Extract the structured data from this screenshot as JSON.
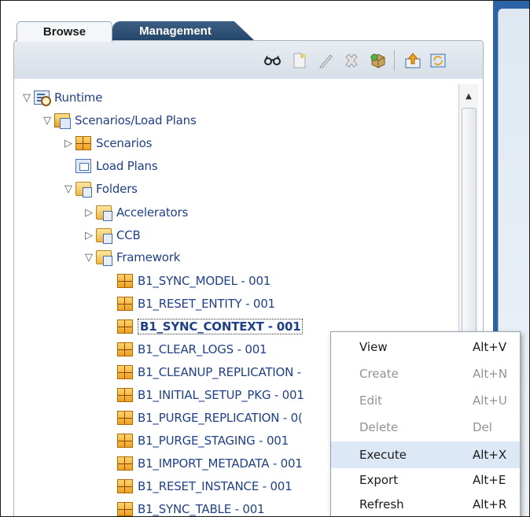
{
  "tabs": {
    "browse": "Browse",
    "management": "Management"
  },
  "toolbar_icons": [
    "glasses-icon",
    "new-document-icon",
    "pencil-icon",
    "delete-x-icon",
    "package-icon",
    "upload-icon",
    "refresh-icon"
  ],
  "tree": {
    "runtime": "Runtime",
    "scenarios_load_plans": "Scenarios/Load Plans",
    "scenarios": "Scenarios",
    "load_plans": "Load Plans",
    "folders": "Folders",
    "accelerators": "Accelerators",
    "ccb": "CCB",
    "framework": "Framework",
    "framework_children": [
      "B1_SYNC_MODEL - 001",
      "B1_RESET_ENTITY - 001",
      "B1_SYNC_CONTEXT - 001",
      "B1_CLEAR_LOGS - 001",
      "B1_CLEANUP_REPLICATION -",
      "B1_INITIAL_SETUP_PKG - 001",
      "B1_PURGE_REPLICATION - 0(",
      "B1_PURGE_STAGING - 001",
      "B1_IMPORT_METADATA - 001",
      "B1_RESET_INSTANCE - 001",
      "B1_SYNC_TABLE - 001"
    ],
    "selected": "B1_SYNC_CONTEXT - 001"
  },
  "context_menu": [
    {
      "label": "View",
      "shortcut": "Alt+V",
      "enabled": true
    },
    {
      "label": "Create",
      "shortcut": "Alt+N",
      "enabled": false
    },
    {
      "label": "Edit",
      "shortcut": "Alt+U",
      "enabled": false
    },
    {
      "label": "Delete",
      "shortcut": "Del",
      "enabled": false
    },
    {
      "label": "Execute",
      "shortcut": "Alt+X",
      "enabled": true,
      "highlighted": true
    },
    {
      "label": "Export",
      "shortcut": "Alt+E",
      "enabled": true
    },
    {
      "label": "Refresh",
      "shortcut": "Alt+R",
      "enabled": true
    }
  ],
  "colors": {
    "tree_text": "#1f3f8f",
    "menu_highlight": "#dce8f6",
    "tab_active_bg": "#24466a",
    "right_strip": "#2a63a8"
  }
}
